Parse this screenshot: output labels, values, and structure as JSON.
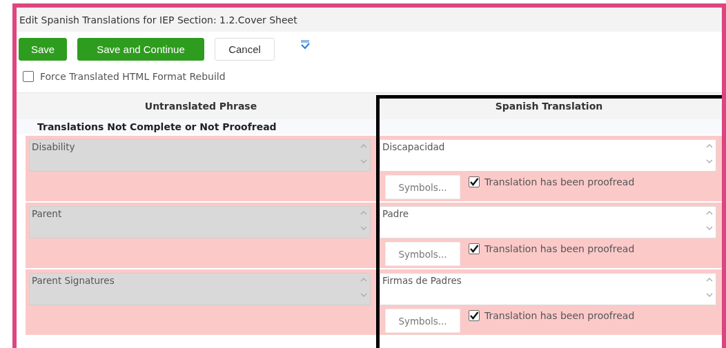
{
  "window": {
    "title": "Edit Spanish Translations for IEP Section: 1.2.Cover Sheet"
  },
  "toolbar": {
    "buttons": [
      {
        "label": "Save",
        "kind": "primary"
      },
      {
        "label": "Save and Continue",
        "kind": "primary"
      },
      {
        "label": "Cancel",
        "kind": "secondary"
      }
    ]
  },
  "options": [
    {
      "label": "Force Translated HTML Format Rebuild",
      "checked": false
    }
  ],
  "table": {
    "columns": [
      "Untranslated Phrase",
      "Spanish Translation"
    ],
    "groups": [
      {
        "title": "Translations Not Complete or Not Proofread",
        "rows": [
          {
            "phrase": "Disability",
            "translation": "Discapacidad",
            "symbols_button": "Symbols...",
            "proofread_label": "Translation has been proofread",
            "proofread": true
          },
          {
            "phrase": "Parent",
            "translation": "Padre",
            "symbols_button": "Symbols...",
            "proofread_label": "Translation has been proofread",
            "proofread": true
          },
          {
            "phrase": "Parent Signatures",
            "translation": "Firmas de Padres",
            "symbols_button": "Symbols...",
            "proofread_label": "Translation has been proofread",
            "proofread": true
          }
        ]
      }
    ]
  }
}
